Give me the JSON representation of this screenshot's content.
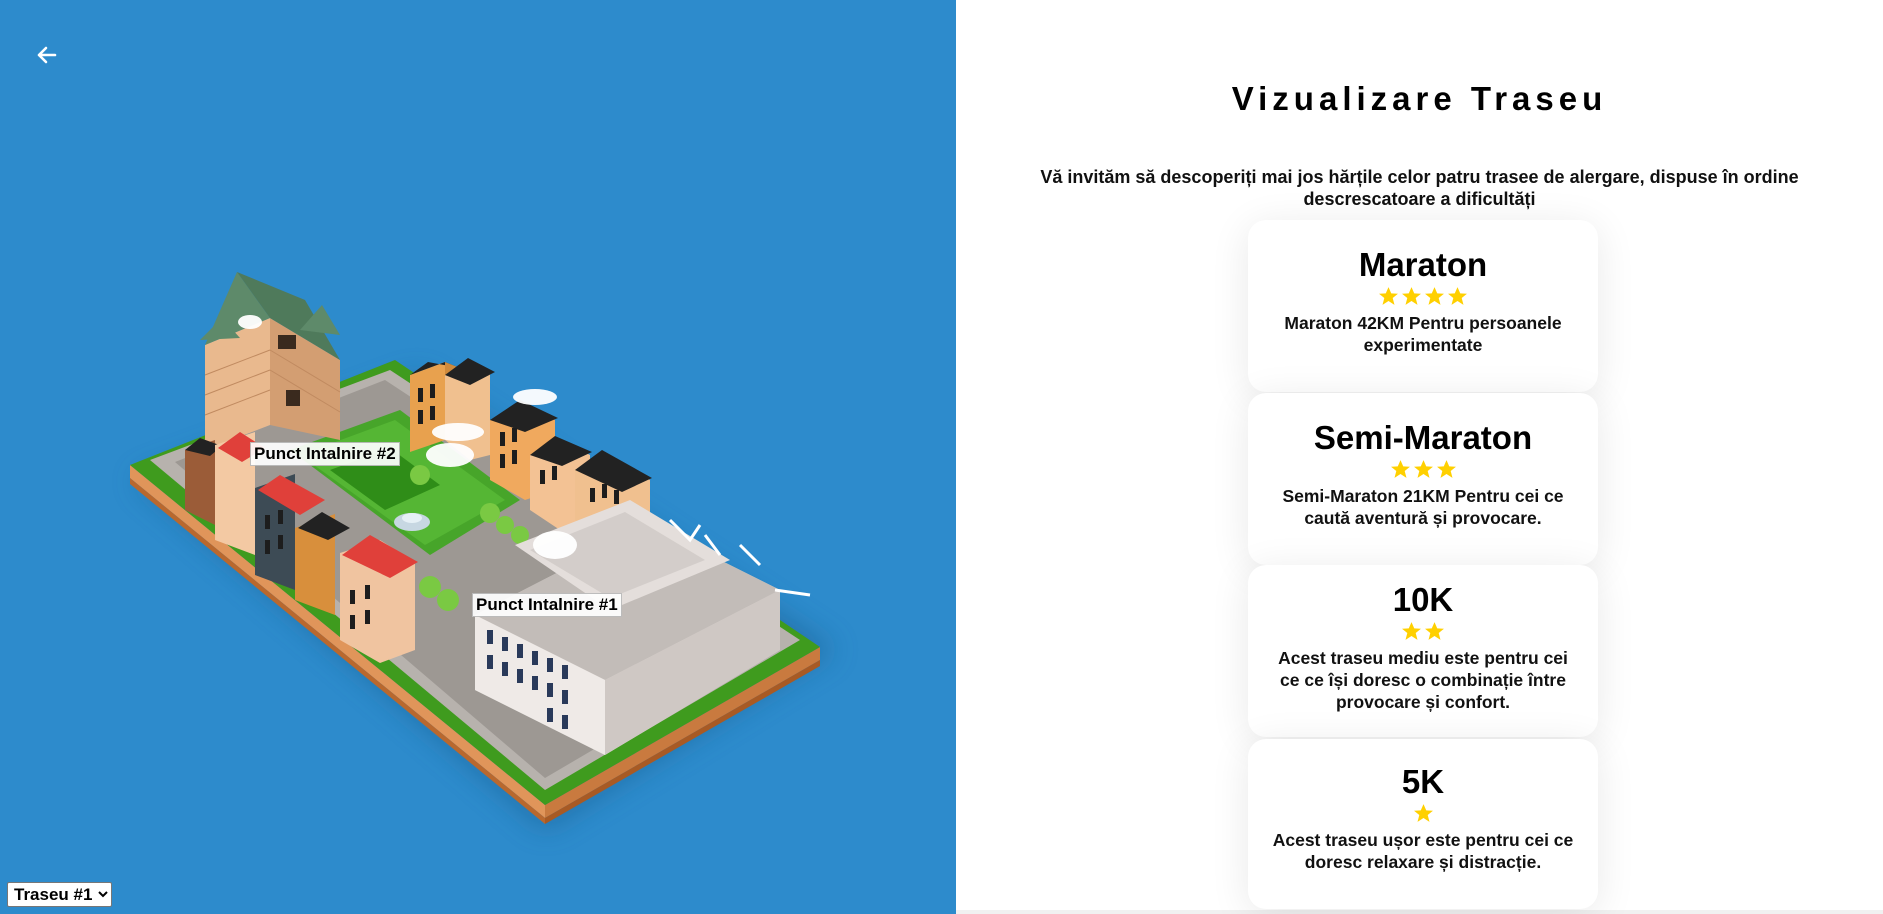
{
  "map": {
    "markers": [
      {
        "id": "marker-2",
        "label": "Punct Intalnire #2"
      },
      {
        "id": "marker-1",
        "label": "Punct Intalnire #1"
      }
    ],
    "route_select": {
      "selected": "Traseu #1",
      "options": [
        "Traseu #1"
      ]
    },
    "background_color": "#2d8bcc"
  },
  "page": {
    "title": "Vizualizare Traseu",
    "intro": "Vă invităm să descoperiți mai jos hărțile celor patru trasee de alergare, dispuse în ordine descrescatoare a dificultăți"
  },
  "routes": [
    {
      "title": "Maraton",
      "stars": 4,
      "description": "Maraton 42KM Pentru persoanele experimentate"
    },
    {
      "title": "Semi-Maraton",
      "stars": 3,
      "description": "Semi-Maraton 21KM Pentru cei ce caută aventură și provocare."
    },
    {
      "title": "10K",
      "stars": 2,
      "description": "Acest traseu mediu este pentru cei ce ce își doresc o combinație între provocare și confort."
    },
    {
      "title": "5K",
      "stars": 1,
      "description": "Acest traseu ușor este pentru cei ce doresc relaxare și distracție."
    }
  ],
  "colors": {
    "star": "#ffd000",
    "accent_panel": "#2d8bcc"
  },
  "icons": {
    "back": "arrow-left-icon",
    "star": "star-icon"
  }
}
